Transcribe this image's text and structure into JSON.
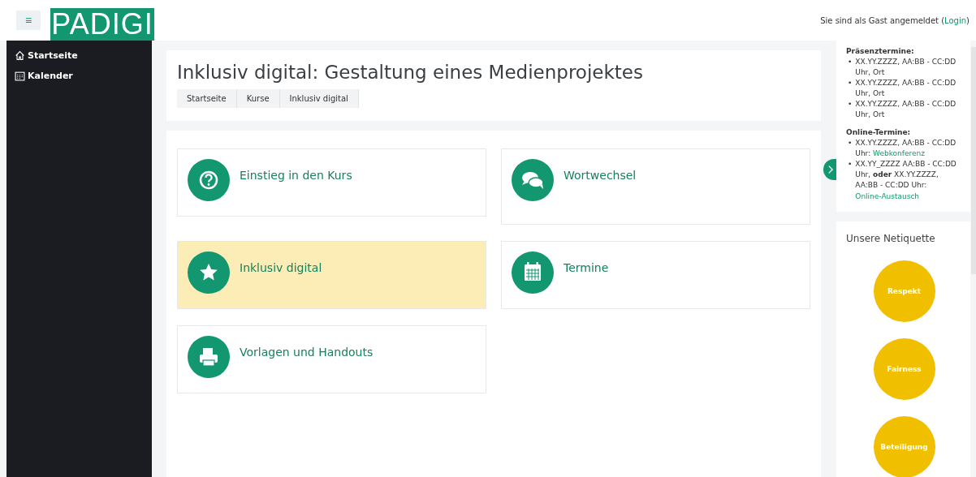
{
  "header": {
    "menu_button": "≡",
    "logo": "PADIGI",
    "login_notice": [
      {
        "text": "Sie sind als Gast angemeldet ("
      },
      {
        "text": "Login",
        "kind": "link"
      },
      {
        "text": ")"
      }
    ]
  },
  "sidebar": {
    "items": [
      {
        "label": "Startseite",
        "kind": "home"
      },
      {
        "label": "Kalender",
        "kind": "calendar"
      }
    ]
  },
  "page": {
    "title": "Inklusiv digital: Gestaltung eines Medienprojektes",
    "breadcrumb": [
      "Startseite",
      "Kurse",
      "Inklusiv digital"
    ]
  },
  "tiles": [
    {
      "label": "Einstieg in den Kurs",
      "kind": "question",
      "selected": false,
      "tall": false
    },
    {
      "label": "Wortwechsel",
      "kind": "chat",
      "selected": false,
      "tall": true
    },
    {
      "label": "Inklusiv digital",
      "kind": "star",
      "selected": true,
      "tall": false
    },
    {
      "label": "Termine",
      "kind": "calendar",
      "selected": false,
      "tall": false
    },
    {
      "label": "Vorlagen und Handouts",
      "kind": "print",
      "selected": false,
      "tall": false
    }
  ],
  "dates": {
    "groups": [
      {
        "heading": "Präsenztermine:",
        "items": [
          {
            "bullet": "•",
            "segments": [
              {
                "text": "XX.YY.ZZZZ, AA:BB - CC:DD Uhr, Ort"
              }
            ]
          },
          {
            "bullet": "•",
            "segments": [
              {
                "text": "XX.YY.ZZZZ, AA:BB - CC:DD Uhr, Ort"
              }
            ]
          },
          {
            "bullet": "•",
            "segments": [
              {
                "text": "XX.YY.ZZZZ, AA:BB - CC:DD Uhr, Ort"
              }
            ]
          }
        ]
      },
      {
        "heading": "Online-Termine:",
        "items": [
          {
            "bullet": "•",
            "segments": [
              {
                "text": "XX.YY.ZZZZ, AA:BB - CC:DD Uhr: "
              },
              {
                "text": "Webkonferenz",
                "kind": "link"
              }
            ]
          },
          {
            "bullet": "•",
            "segments": [
              {
                "text": "XX.YY_ZZZZ AA:BB - CC:DD Uhr, **oder** XX.YY.ZZZZ, AA:BB - CC:DD Uhr: "
              },
              {
                "text": "Online-Austausch",
                "kind": "link"
              }
            ]
          }
        ]
      }
    ]
  },
  "netiquette": {
    "title": "Unsere Netiquette",
    "values": [
      "Respekt",
      "Fairness",
      "Beteiligung"
    ]
  }
}
